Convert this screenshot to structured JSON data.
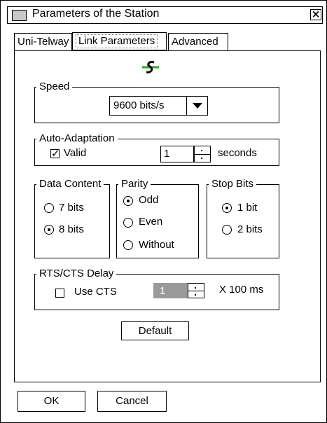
{
  "window": {
    "title": "Parameters of the Station"
  },
  "tabs": [
    {
      "label": "Uni-Telway"
    },
    {
      "label": "Link Parameters",
      "active": true
    },
    {
      "label": "Advanced"
    }
  ],
  "icons": {
    "window": "window-icon",
    "close": "close-icon",
    "connection": "connection-icon"
  },
  "speed": {
    "legend": "Speed",
    "value": "9600 bits/s"
  },
  "auto_adaptation": {
    "legend": "Auto-Adaptation",
    "valid_label": "Valid",
    "valid_checked": true,
    "value": "1",
    "unit": "seconds"
  },
  "data_content": {
    "legend": "Data Content",
    "options": [
      "7 bits",
      "8 bits"
    ],
    "selected": "8 bits"
  },
  "parity": {
    "legend": "Parity",
    "options": [
      "Odd",
      "Even",
      "Without"
    ],
    "selected": "Odd"
  },
  "stop_bits": {
    "legend": "Stop Bits",
    "options": [
      "1 bit",
      "2 bits"
    ],
    "selected": "1 bit"
  },
  "rts_cts": {
    "legend": "RTS/CTS Delay",
    "use_cts_label": "Use CTS",
    "use_cts_checked": false,
    "value": "1",
    "unit": "X 100 ms"
  },
  "buttons": {
    "default": "Default",
    "ok": "OK",
    "cancel": "Cancel"
  },
  "colors": {
    "disabled_field": "#9a9a9a",
    "icon_green": "#22aa22"
  }
}
